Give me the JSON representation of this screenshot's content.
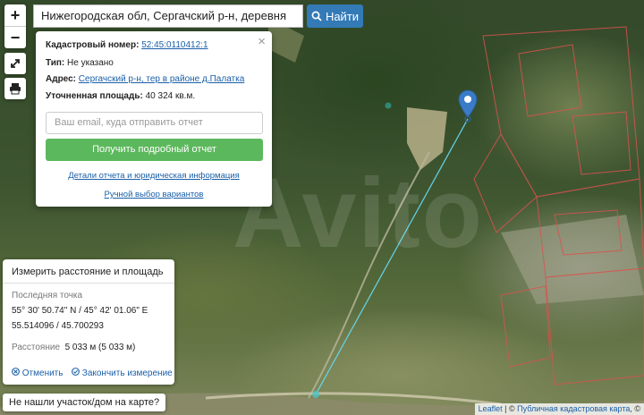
{
  "search": {
    "value": "Нижегородская обл, Сергачский р-н, деревня Палатка",
    "button_label": "Найти"
  },
  "zoom": {
    "in_label": "+",
    "out_label": "−"
  },
  "watermark": "Avito",
  "popup": {
    "close_label": "×",
    "cadastral_label": "Кадастровый номер:",
    "cadastral_value": "52:45:0110412:1",
    "type_label": "Тип:",
    "type_value": "Не указано",
    "address_label": "Адрес:",
    "address_value": "Сергачский р-н, тер в районе д.Палатка",
    "area_label": "Уточненная площадь:",
    "area_value": "40 324 кв.м.",
    "email_placeholder": "Ваш email, куда отправить отчет",
    "report_button": "Получить подробный отчет",
    "details_link": "Детали отчета и юридическая информация",
    "manual_link": "Ручной выбор вариантов"
  },
  "measure": {
    "title": "Измерить расстояние и площадь",
    "last_point_label": "Последняя точка",
    "coords_dms": "55° 30' 50.74\" N / 45° 42' 01.06\" E",
    "coords_decimal": "55.514096 / 45.700293",
    "distance_label": "Расстояние",
    "distance_value": "5 033 м (5 033 м)",
    "cancel_label": "Отменить",
    "finish_label": "Закончить измерение"
  },
  "not_found_button": "Не нашли участок/дом на карте?",
  "attribution": {
    "leaflet": "Leaflet",
    "separator": " | © ",
    "source": "Публичная кадастровая карта",
    "suffix": ", ©"
  }
}
